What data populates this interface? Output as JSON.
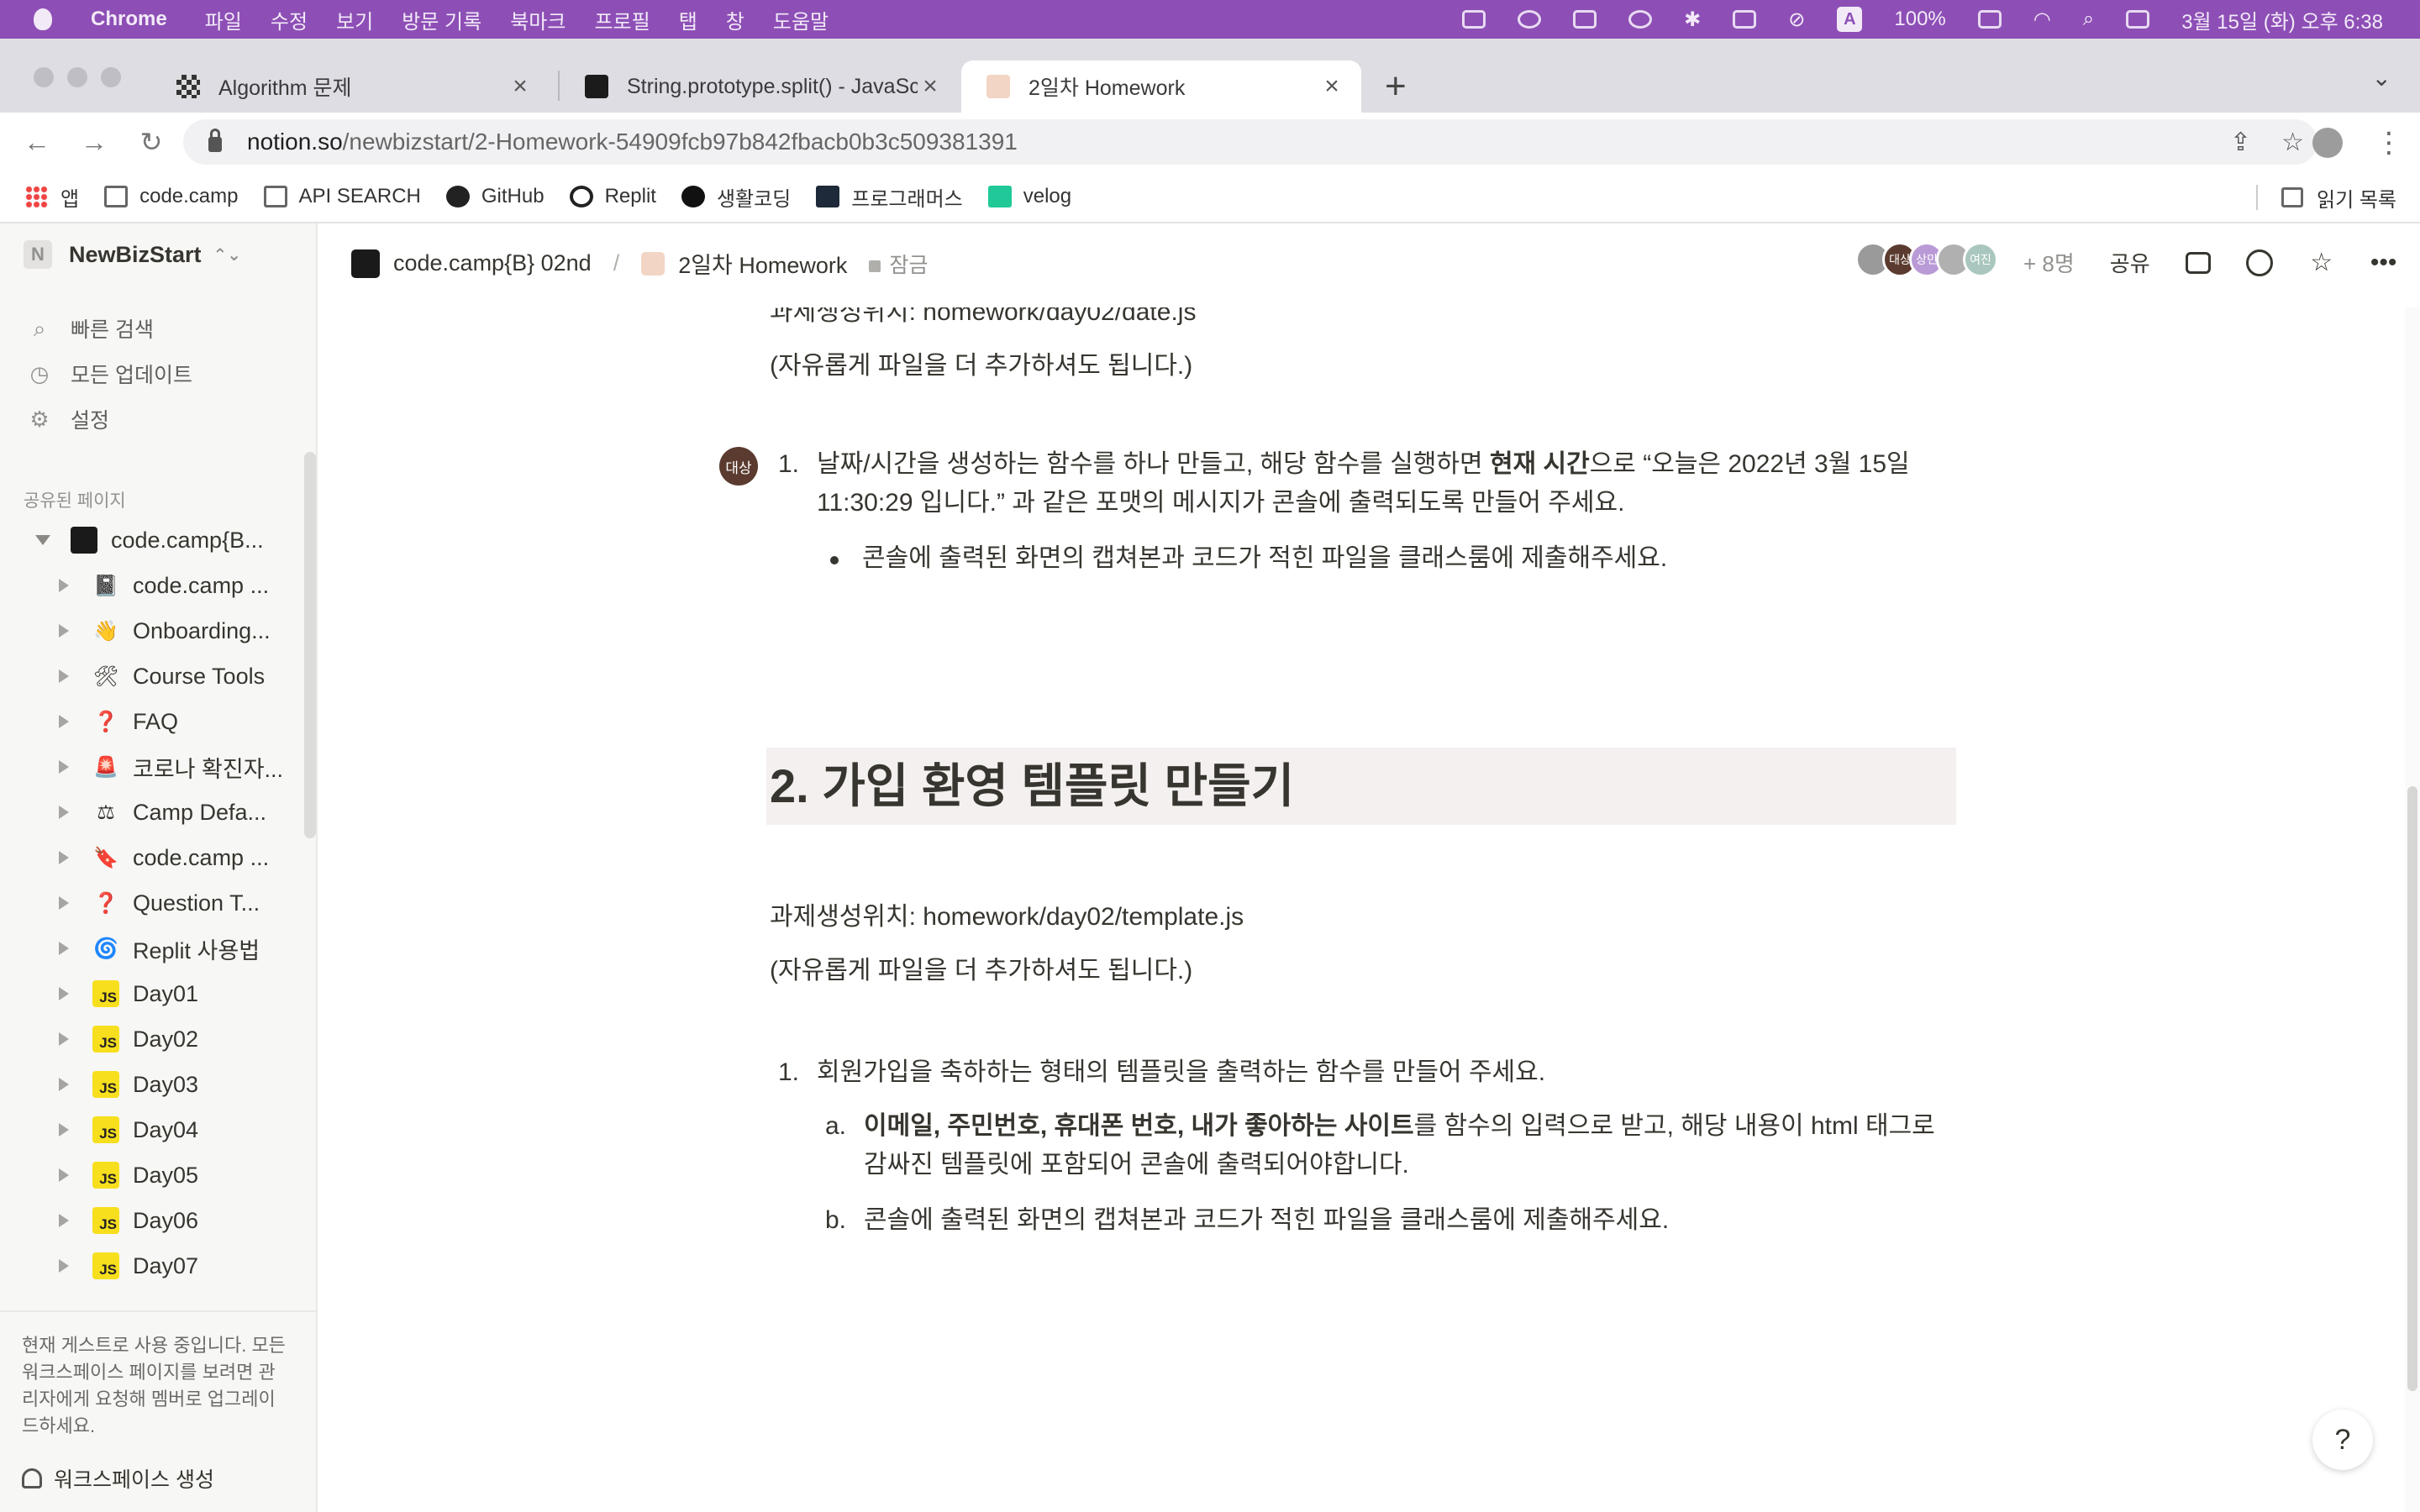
{
  "menubar": {
    "app_name": "Chrome",
    "items": [
      "파일",
      "수정",
      "보기",
      "방문 기록",
      "북마크",
      "프로필",
      "탭",
      "창",
      "도움말"
    ],
    "battery": "100%",
    "datetime": "3월 15일 (화) 오후 6:38",
    "input_indicator": "A"
  },
  "tabs": [
    {
      "label": "Algorithm 문제",
      "close": "×"
    },
    {
      "label": "String.prototype.split() - JavaScript",
      "close": "×"
    },
    {
      "label": "2일차 Homework",
      "close": "×"
    }
  ],
  "newtab": "+",
  "tab_menu": "⌄",
  "address": {
    "domain": "notion.so",
    "path": "/newbizstart/2-Homework-54909fcb97b842fbacb0b3c509381391"
  },
  "bookmarks": {
    "items": [
      "앱",
      "code.camp",
      "API SEARCH",
      "GitHub",
      "Replit",
      "생활코딩",
      "프로그래머스",
      "velog"
    ],
    "reading_list": "읽기 목록"
  },
  "sidebar": {
    "workspace": "NewBizStart",
    "workspace_initial": "N",
    "nav": [
      "빠른 검색",
      "모든 업데이트",
      "설정"
    ],
    "section_title": "공유된 페이지",
    "root": "code.camp{B...",
    "pages": [
      {
        "label": "code.camp ...",
        "icon": "📓"
      },
      {
        "label": "Onboarding...",
        "icon": "👋"
      },
      {
        "label": "Course Tools",
        "icon": "🛠"
      },
      {
        "label": "FAQ",
        "icon": "❓"
      },
      {
        "label": "코로나 확진자...",
        "icon": "🚨"
      },
      {
        "label": "Camp Defa...",
        "icon": "⚖"
      },
      {
        "label": "code.camp ...",
        "icon": "🔖"
      },
      {
        "label": "Question T...",
        "icon": "❓"
      },
      {
        "label": "Replit 사용법",
        "icon": "🌀"
      },
      {
        "label": "Day01",
        "icon": "JS"
      },
      {
        "label": "Day02",
        "icon": "JS"
      },
      {
        "label": "Day03",
        "icon": "JS"
      },
      {
        "label": "Day04",
        "icon": "JS"
      },
      {
        "label": "Day05",
        "icon": "JS"
      },
      {
        "label": "Day06",
        "icon": "JS"
      },
      {
        "label": "Day07",
        "icon": "JS"
      }
    ],
    "guest_note": "현재 게스트로 사용 중입니다. 모든 워크스페이스 페이지를 보려면 관리자에게 요청해 멤버로 업그레이드하세요.",
    "create_workspace": "워크스페이스 생성"
  },
  "topbar": {
    "crumb_parent": "code.camp{B} 02nd",
    "crumb_sep": "/",
    "crumb_current": "2일차 Homework",
    "locked": "잠금",
    "avatar_labels": [
      "",
      "대상",
      "상민",
      "",
      "여진"
    ],
    "more_people": "+ 8명",
    "share": "공유",
    "star": "☆",
    "more": "•••"
  },
  "content": {
    "top_path": "과제생성위치: homework/day02/date.js",
    "top_note": "(자유롭게 파일을 더 추가하셔도 됩니다.)",
    "comment_avatar": "대상",
    "q1_num": "1.",
    "q1_line1_a": "날짜/시간을 생성하는 함수를 하나 만들고, 해당 함수를 실행하면 ",
    "q1_line1_bold": "현재 시간",
    "q1_line1_b": "으로 “오늘은 2022년 3월 15일",
    "q1_line2": "11:30:29 입니다.” 과 같은 포맷의 메시지가 콘솔에 출력되도록 만들어 주세요.",
    "q1_bullet": "콘솔에 출력된 화면의 캡쳐본과 코드가 적힌 파일을 클래스룸에 제출해주세요.",
    "h2": "2. 가입 환영 템플릿 만들기",
    "path2": "과제생성위치: homework/day02/template.js",
    "note2": "(자유롭게 파일을 더 추가하셔도 됩니다.)",
    "q2_num": "1.",
    "q2_text": "회원가입을 축하하는 형태의 템플릿을 출력하는 함수를 만들어 주세요.",
    "q2a_marker": "a.",
    "q2a_bold": "이메일, 주민번호, 휴대폰 번호, 내가 좋아하는 사이트",
    "q2a_rest": "를 함수의 입력으로 받고, 해당 내용이 html 태그로",
    "q2a_line2": "감싸진 템플릿에 포함되어 콘솔에 출력되어야합니다.",
    "q2b_marker": "b.",
    "q2b_text": "콘솔에 출력된 화면의 캡쳐본과 코드가 적힌 파일을 클래스룸에 제출해주세요."
  },
  "help": "?"
}
